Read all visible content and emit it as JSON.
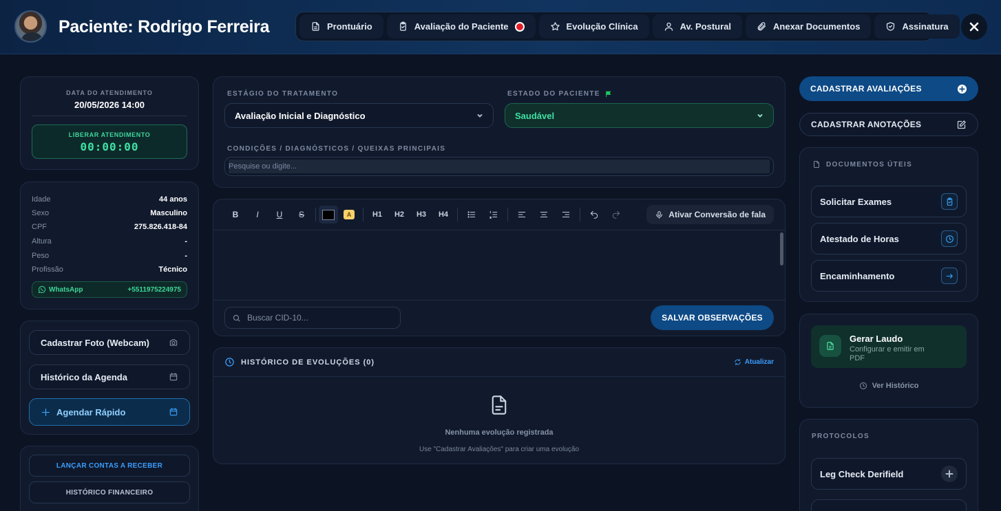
{
  "header": {
    "title": "Paciente: Rodrigo Ferreira",
    "tabs": [
      {
        "label": "Prontuário",
        "icon": "file-icon"
      },
      {
        "label": "Avaliação do Paciente",
        "icon": "clipboard-icon"
      },
      {
        "label": "Evolução Clínica",
        "icon": "star-icon"
      },
      {
        "label": "Av. Postural",
        "icon": "user-icon"
      },
      {
        "label": "Anexar Documentos",
        "icon": "paperclip-icon"
      },
      {
        "label": "Assinatura",
        "icon": "shield-icon"
      }
    ]
  },
  "left": {
    "date_label": "DATA DO ATENDIMENTO",
    "date_value": "20/05/2026 14:00",
    "release_label": "LIBERAR ATENDIMENTO",
    "timer": "00:00:00",
    "info": [
      {
        "key": "Idade",
        "value": "44 anos"
      },
      {
        "key": "Sexo",
        "value": "Masculino"
      },
      {
        "key": "CPF",
        "value": "275.826.418-84"
      },
      {
        "key": "Altura",
        "value": "-"
      },
      {
        "key": "Peso",
        "value": "-"
      },
      {
        "key": "Profissão",
        "value": "Técnico"
      }
    ],
    "whatsapp_label": "WhatsApp",
    "whatsapp_number": "+5511975224975",
    "actions": {
      "photo": "Cadastrar Foto (Webcam)",
      "schedule_history": "Histórico da Agenda",
      "quick_schedule": "Agendar Rápido"
    },
    "finance": {
      "receivable": "LANÇAR CONTAS A RECEBER",
      "history": "HISTÓRICO FINANCEIRO"
    }
  },
  "treatment": {
    "stage_label": "ESTÁGIO DO TRATAMENTO",
    "stage_value": "Avaliação Inicial e Diagnóstico",
    "state_label": "ESTADO DO PACIENTE",
    "state_value": "Saudável",
    "conditions_label": "CONDIÇÕES / DIAGNÓSTICOS / QUEIXAS PRINCIPAIS",
    "conditions_placeholder": "Pesquise ou digite..."
  },
  "editor": {
    "toolbar": {
      "bold": "B",
      "italic": "I",
      "underline": "U",
      "strike": "S",
      "highlight": "A",
      "h1": "H1",
      "h2": "H2",
      "h3": "H3",
      "h4": "H4"
    },
    "speech_label": "Ativar Conversão de fala",
    "cid_placeholder": "Buscar CID-10...",
    "save_label": "SALVAR OBSERVAÇÕES"
  },
  "history": {
    "title": "HISTÓRICO DE EVOLUÇÕES (0)",
    "refresh_label": "Atualizar",
    "empty_title": "Nenhuma evolução registrada",
    "empty_hint": "Use \"Cadastrar Avaliações\" para criar uma evolução"
  },
  "right": {
    "register_evaluations": "CADASTRAR AVALIAÇÕES",
    "register_notes": "CADASTRAR ANOTAÇÕES",
    "documents_title": "DOCUMENTOS ÚTEIS",
    "documents": [
      "Solicitar Exames",
      "Atestado de Horas",
      "Encaminhamento"
    ],
    "report_title": "Gerar Laudo",
    "report_subtitle": "Configurar e emitir em PDF",
    "view_history": "Ver Histórico",
    "protocols_title": "PROTOCOLOS",
    "protocols": [
      "Leg Check Derifield"
    ]
  },
  "colors": {
    "accent_blue": "#0d4a86",
    "accent_green": "#3fe0a2",
    "record_red": "#e11d2a",
    "background": "#0c1323"
  }
}
